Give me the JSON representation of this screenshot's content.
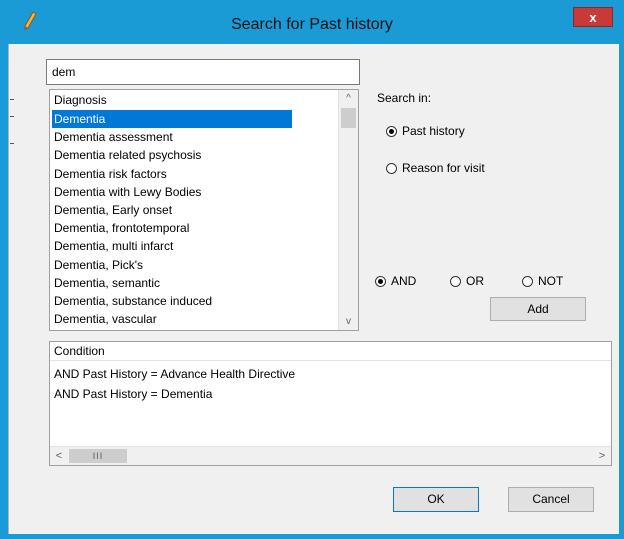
{
  "window": {
    "title": "Search for Past history",
    "close_label": "x"
  },
  "search": {
    "value": "dem"
  },
  "list": {
    "header": "Diagnosis",
    "items": [
      "Dementia",
      "Dementia assessment",
      "Dementia related psychosis",
      "Dementia risk factors",
      "Dementia with Lewy Bodies",
      "Dementia, Early onset",
      "Dementia, frontotemporal",
      "Dementia, multi infarct",
      "Dementia, Pick's",
      "Dementia, semantic",
      "Dementia, substance induced",
      "Dementia, vascular"
    ],
    "selected_index": 0,
    "scroll_up": "^",
    "scroll_down": "v"
  },
  "search_in": {
    "label": "Search in:",
    "options": [
      "Past history",
      "Reason for visit"
    ],
    "selected": "Past history"
  },
  "logic": {
    "options": [
      "AND",
      "OR",
      "NOT"
    ],
    "selected": "AND"
  },
  "add_label": "Add",
  "conditions": {
    "header": "Condition",
    "rows": [
      "AND Past History = Advance Health Directive",
      "AND Past History = Dementia"
    ],
    "scroll_left": "<",
    "scroll_right": ">",
    "thumb_grip": "III"
  },
  "buttons": {
    "ok": "OK",
    "cancel": "Cancel"
  },
  "colors": {
    "titlebar": "#1a9bd6",
    "selection": "#0078d7",
    "close": "#c73a3a"
  }
}
